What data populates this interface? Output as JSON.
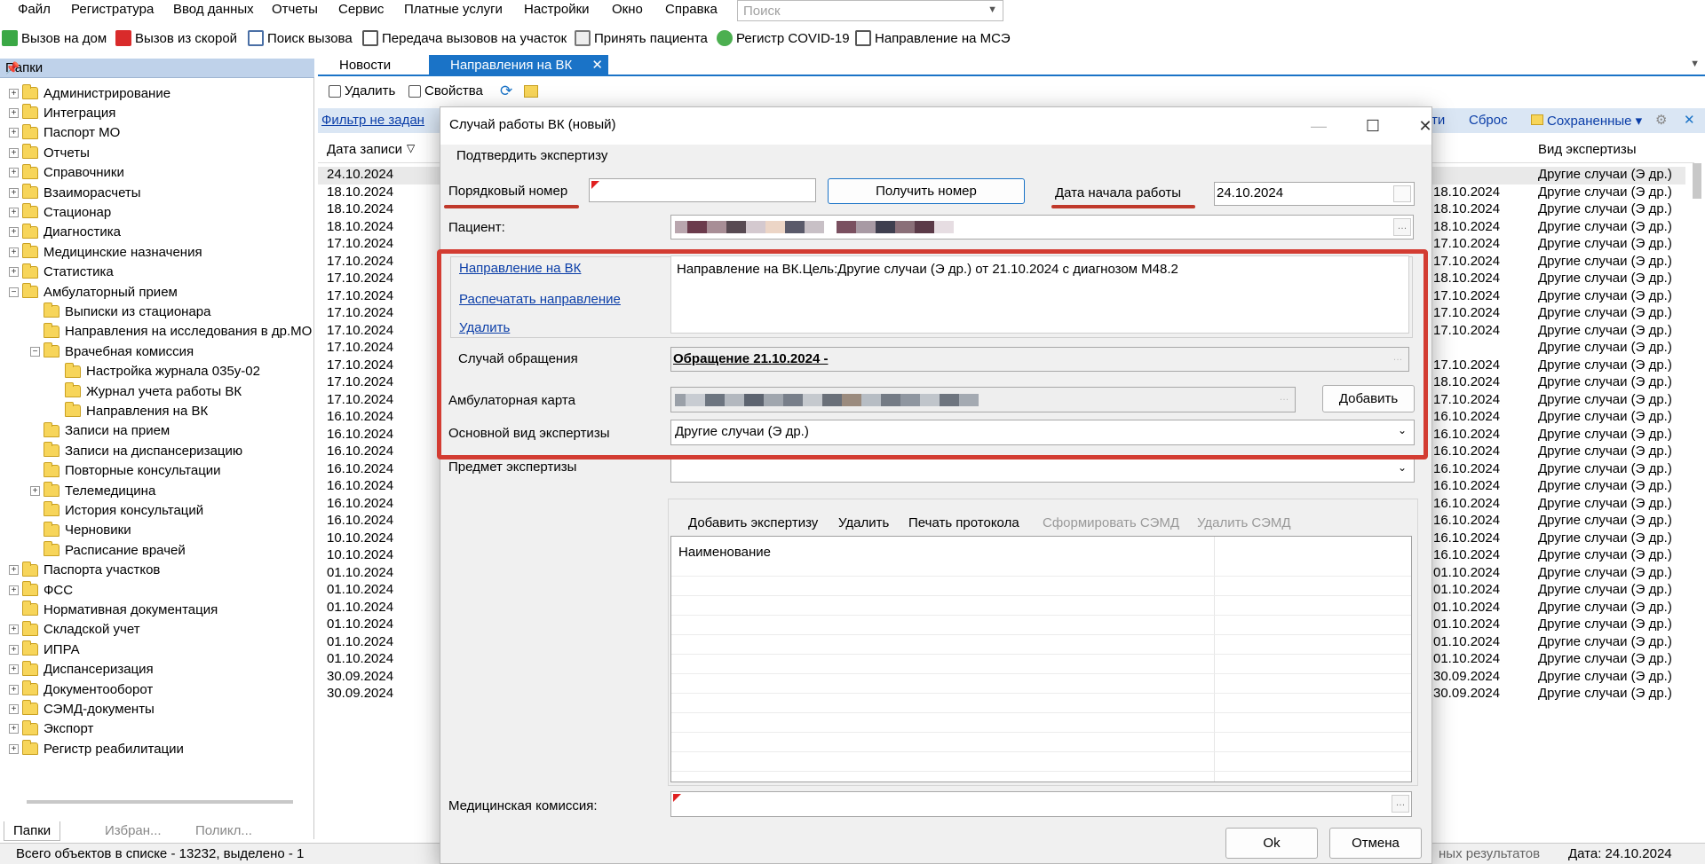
{
  "menu": [
    "Файл",
    "Регистратура",
    "Ввод данных",
    "Отчеты",
    "Сервис",
    "Платные услуги",
    "Настройки",
    "Окно",
    "Справка"
  ],
  "search": {
    "placeholder": "Поиск"
  },
  "toolbar": [
    "Вызов на дом",
    "Вызов из скорой",
    "Поиск вызова",
    "Передача вызовов на участок",
    "Принять пациента",
    "Регистр COVID-19",
    "Направление на МСЭ"
  ],
  "left_panel": {
    "title": "Папки",
    "items": [
      "Администрирование",
      "Интеграция",
      "Паспорт МО",
      "Отчеты",
      "Справочники",
      "Взаиморасчеты",
      "Стационар",
      "Диагностика",
      "Медицинские назначения",
      "Статистика",
      "Амбулаторный прием",
      "Выписки из стационара",
      "Направления на исследования в др.МО",
      "Врачебная комиссия",
      "Настройка журнала 035у-02",
      "Журнал учета работы ВК",
      "Направления на ВК",
      "Записи на прием",
      "Записи на диспансеризацию",
      "Повторные консультации",
      "Телемедицина",
      "История консультаций",
      "Черновики",
      "Расписание врачей",
      "Паспорта участков",
      "ФСС",
      "Нормативная документация",
      "Складской учет",
      "ИПРА",
      "Диспансеризация",
      "Документооборот",
      "СЭМД-документы",
      "Экспорт",
      "Регистр реабилитации"
    ],
    "tabs": [
      "Папки",
      "Избран...",
      "Поликл..."
    ]
  },
  "doc_tabs": [
    "Новости",
    "Направления на ВК"
  ],
  "list_toolbar": {
    "delete": "Удалить",
    "props": "Свойства"
  },
  "filter": {
    "text": "Фильтр не задан",
    "partial": "ти",
    "reset": "Сброс",
    "saved": "Сохраненные"
  },
  "grid": {
    "col_date": "Дата записи",
    "col_vid": "Вид экспертизы",
    "dates": [
      "24.10.2024",
      "18.10.2024",
      "18.10.2024",
      "18.10.2024",
      "17.10.2024",
      "17.10.2024",
      "17.10.2024",
      "17.10.2024",
      "17.10.2024",
      "17.10.2024",
      "17.10.2024",
      "17.10.2024",
      "17.10.2024",
      "17.10.2024",
      "16.10.2024",
      "16.10.2024",
      "16.10.2024",
      "16.10.2024",
      "16.10.2024",
      "16.10.2024",
      "16.10.2024",
      "10.10.2024",
      "10.10.2024",
      "01.10.2024",
      "01.10.2024",
      "01.10.2024",
      "01.10.2024",
      "01.10.2024",
      "01.10.2024",
      "30.09.2024",
      "30.09.2024"
    ],
    "dates2": [
      "",
      "18.10.2024",
      "18.10.2024",
      "18.10.2024",
      "17.10.2024",
      "17.10.2024",
      "18.10.2024",
      "17.10.2024",
      "17.10.2024",
      "17.10.2024",
      "",
      "17.10.2024",
      "18.10.2024",
      "17.10.2024",
      "16.10.2024",
      "16.10.2024",
      "16.10.2024",
      "16.10.2024",
      "16.10.2024",
      "16.10.2024",
      "16.10.2024",
      "16.10.2024",
      "16.10.2024",
      "01.10.2024",
      "01.10.2024",
      "01.10.2024",
      "01.10.2024",
      "01.10.2024",
      "01.10.2024",
      "30.09.2024",
      "30.09.2024"
    ],
    "vid": "Другие случаи (Э др.)"
  },
  "status": {
    "left": "Всего объектов в списке - 13232, выделено - 1",
    "mid": "ных результатов",
    "date": "Дата: 24.10.2024"
  },
  "dialog": {
    "title": "Случай работы ВК (новый)",
    "confirm": "Подтвердить экспертизу",
    "order_label": "Порядковый номер",
    "get_number": "Получить номер",
    "start_date_label": "Дата начала работы",
    "start_date": "24.10.2024",
    "patient_label": "Пациент:",
    "link_direction": "Направление на ВК",
    "link_print": "Распечатать направление",
    "link_delete": "Удалить",
    "direction_text": "Направление на ВК.Цель:Другие случаи (Э др.) от 21.10.2024 с диагнозом M48.2",
    "case_label": "Случай обращения",
    "case_value": "Обращение 21.10.2024 -",
    "card_label": "Амбулаторная карта",
    "add": "Добавить",
    "main_type_label": "Основной вид экспертизы",
    "main_type": "Другие случаи (Э др.)",
    "subject_label": "Предмет экспертизы",
    "exp_toolbar": [
      "Добавить экспертизу",
      "Удалить",
      "Печать протокола",
      "Сформировать СЭМД",
      "Удалить СЭМД"
    ],
    "exp_col": "Наименование",
    "commission_label": "Медицинская комиссия:",
    "ok": "Ok",
    "cancel": "Отмена"
  }
}
